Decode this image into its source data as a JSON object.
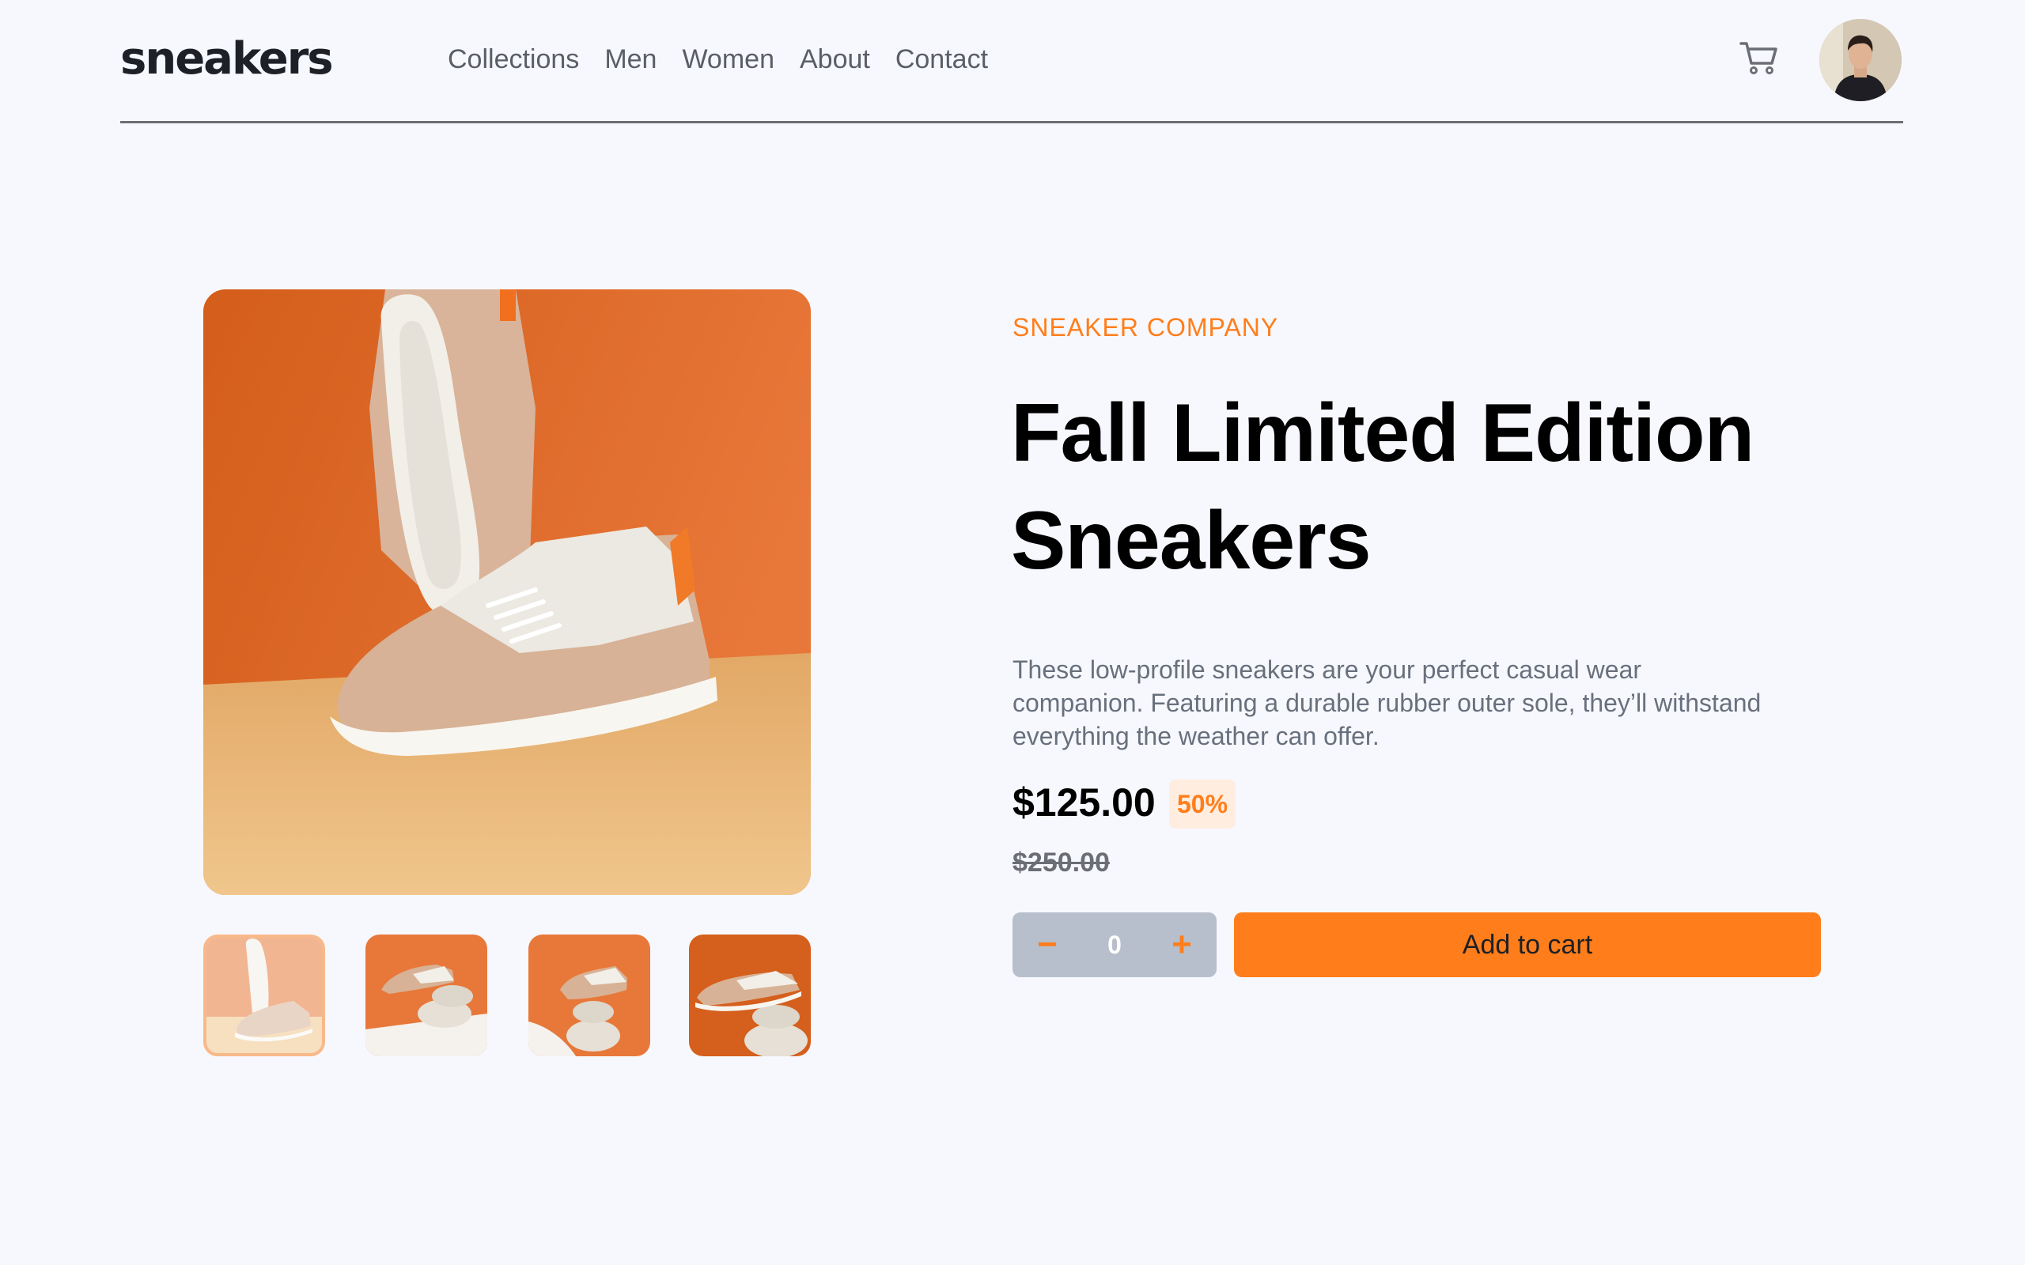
{
  "header": {
    "logo": "sneakers",
    "nav": [
      "Collections",
      "Men",
      "Women",
      "About",
      "Contact"
    ],
    "icons": {
      "cart": "cart-icon",
      "avatar": "user-avatar"
    }
  },
  "gallery": {
    "thumbnail_count": 4,
    "active_thumbnail": 1
  },
  "product": {
    "brand": "SNEAKER COMPANY",
    "title_line1": "Fall Limited Edition",
    "title_line2": "Sneakers",
    "description": "These low-profile sneakers are your perfect casual wear companion. Featuring a durable rubber outer sole, they’ll withstand everything the weather can offer.",
    "price": "$125.00",
    "discount": "50%",
    "original_price": "$250.00"
  },
  "cart_controls": {
    "minus_label": "−",
    "quantity": "0",
    "plus_label": "+",
    "add_button": "Add to cart"
  },
  "colors": {
    "accent": "#ff7e1b",
    "accent_light": "#ffede0",
    "background": "#f7f8fd",
    "text_dark": "#1d2026",
    "text_muted": "#68707d",
    "qty_background": "#b8bfcc"
  }
}
